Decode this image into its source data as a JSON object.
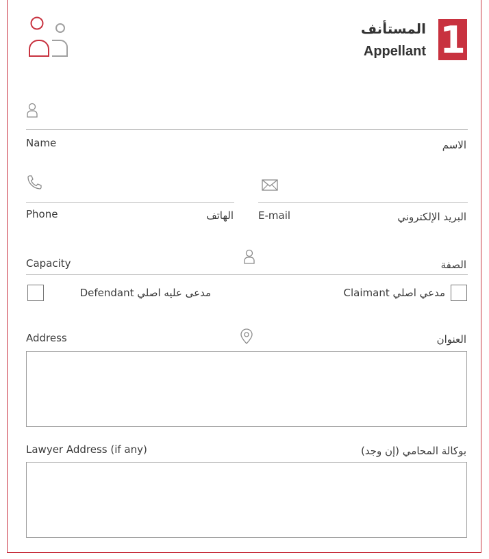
{
  "section": {
    "number": "1",
    "title_ar": "المستأنف",
    "title_en": "Appellant",
    "header_icon": "users-icon",
    "accent_color": "#c8323f"
  },
  "fields": {
    "name": {
      "label_en": "Name",
      "label_ar": "الاسم",
      "icon": "user-icon"
    },
    "phone": {
      "label_en": "Phone",
      "label_ar": "الهاتف",
      "icon": "phone-icon"
    },
    "email": {
      "label_en": "E-mail",
      "label_ar": "البريد الإلكتروني",
      "icon": "mail-icon"
    },
    "capacity": {
      "label_en": "Capacity",
      "label_ar": "الصفة",
      "icon": "user-icon"
    },
    "address": {
      "label_en": "Address",
      "label_ar": "العنوان",
      "icon": "location-pin-icon"
    },
    "lawyer_address": {
      "label_en": "Lawyer Address (if any)",
      "label_ar": "بوكالة المحامي (إن وجد)"
    }
  },
  "checkboxes": {
    "defendant": {
      "label": "مدعى عليه اصلي Defendant",
      "checked": false
    },
    "claimant": {
      "label": "مدعي اصلي Claimant",
      "checked": false
    }
  }
}
